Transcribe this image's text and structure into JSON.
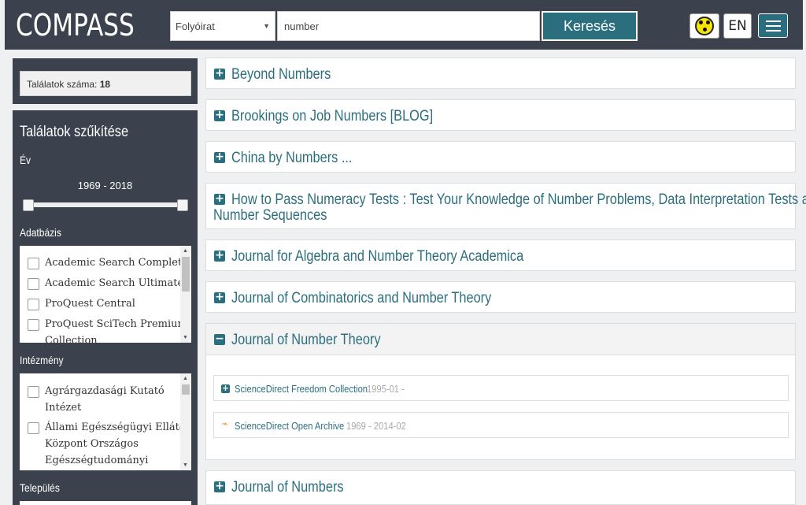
{
  "header": {
    "logo": "COMPASS",
    "search_type": "Folyóirat",
    "search_value": "number",
    "search_button": "Keresés",
    "lang_button": "EN"
  },
  "sidebar": {
    "count_label": "Találatok száma:",
    "count_value": "18",
    "filter_title": "Találatok szűkítése",
    "year_label": "Év",
    "year_range": "1969 - 2018",
    "database_label": "Adatbázis",
    "databases": [
      "Academic Search Complete",
      "Academic Search Ultimate",
      "ProQuest Central",
      "ProQuest SciTech Premium Collection"
    ],
    "institution_label": "Intézmény",
    "institutions": [
      "Agrárgazdasági Kutató Intézet",
      "Állami Egészségügyi Ellátó Központ Országos Egészségtudományi"
    ],
    "city_label": "Település"
  },
  "results": [
    {
      "title": "Beyond Numbers",
      "expanded": false
    },
    {
      "title": "Brookings on Job Numbers [BLOG]",
      "expanded": false
    },
    {
      "title": "China by Numbers ...",
      "expanded": false
    },
    {
      "title_line1": "How to Pass Numeracy Tests : Test Your Knowledge of Number Problems, Data Interpretation Tests and",
      "title_line2": "Number Sequences",
      "expanded": false
    },
    {
      "title": "Journal for Algebra and Number Theory Academica",
      "expanded": false
    },
    {
      "title": "Journal of Combinatorics and Number Theory",
      "expanded": false
    },
    {
      "title": "Journal of Number Theory",
      "expanded": true,
      "sources": [
        {
          "name": "ScienceDirect Freedom Collection",
          "date": "1995-01 -",
          "icon": "plus-icon"
        },
        {
          "name": "ScienceDirect Open Archive",
          "date": "1969 - 2014-02",
          "icon": "rss-icon"
        }
      ]
    },
    {
      "title": "Journal of Numbers",
      "expanded": false
    }
  ],
  "colors": {
    "header_bg": "#3b424d",
    "accent": "#2b6f7e",
    "accessibility_yellow": "#f7e600"
  }
}
